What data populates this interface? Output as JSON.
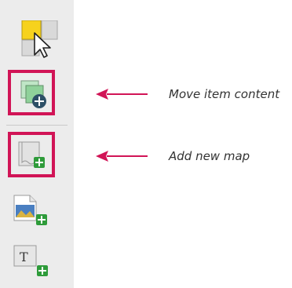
{
  "toolbar": {
    "tools": [
      {
        "name": "select-move-item",
        "icon": "select-move-item-icon",
        "selected": false
      },
      {
        "name": "move-item-content",
        "icon": "move-item-content-icon",
        "selected": true
      },
      {
        "name": "add-new-map",
        "icon": "add-map-icon",
        "selected": true
      },
      {
        "name": "add-picture",
        "icon": "add-picture-icon",
        "selected": false
      },
      {
        "name": "add-label",
        "icon": "add-label-icon",
        "selected": false
      }
    ]
  },
  "callouts": {
    "move_item_content": "Move item content",
    "add_new_map": "Add new map"
  },
  "colors": {
    "highlight": "#d11456",
    "arrow": "#d11456",
    "toolbar_bg": "#ececec",
    "plus_green": "#2e9b3a",
    "badge_dark": "#2d4f66"
  }
}
